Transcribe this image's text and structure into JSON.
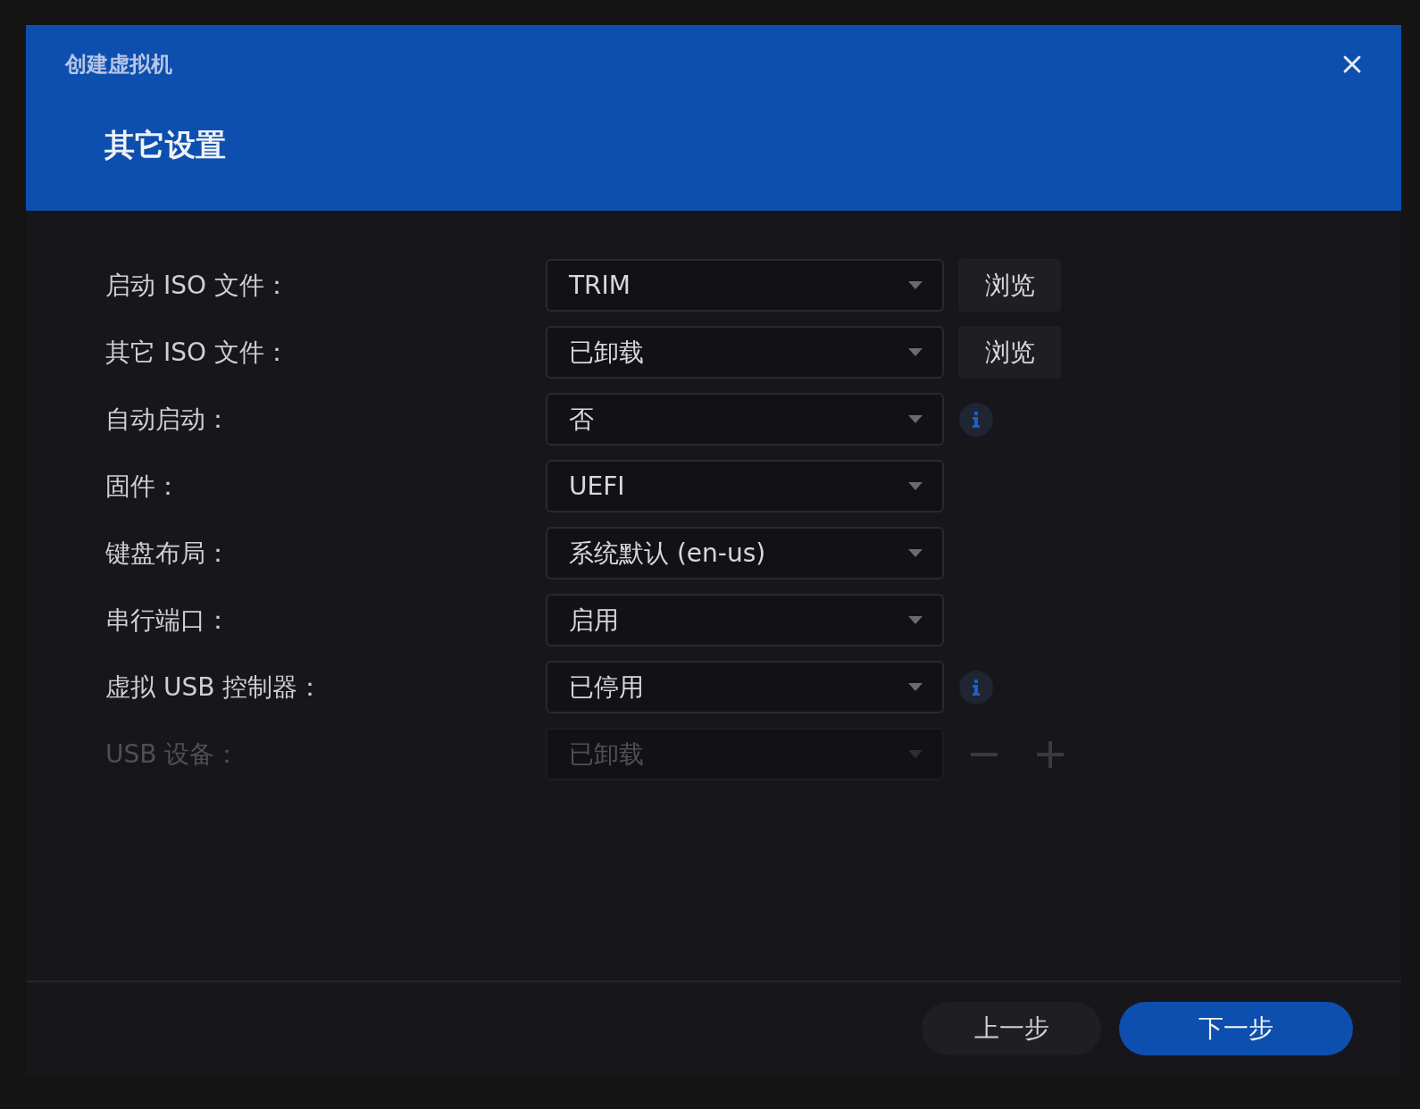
{
  "dialog": {
    "title": "创建虚拟机",
    "heading": "其它设置"
  },
  "rows": [
    {
      "label": "启动 ISO 文件：",
      "value": "TRIM",
      "disabled": false,
      "extra": {
        "kind": "browse",
        "label": "浏览"
      }
    },
    {
      "label": "其它 ISO 文件：",
      "value": "已卸载",
      "disabled": false,
      "extra": {
        "kind": "browse",
        "label": "浏览"
      }
    },
    {
      "label": "自动启动：",
      "value": "否",
      "disabled": false,
      "extra": {
        "kind": "info"
      }
    },
    {
      "label": "固件：",
      "value": "UEFI",
      "disabled": false
    },
    {
      "label": "键盘布局：",
      "value": "系统默认 (en-us)",
      "disabled": false
    },
    {
      "label": "串行端口：",
      "value": "启用",
      "disabled": false
    },
    {
      "label": "虚拟 USB 控制器：",
      "value": "已停用",
      "disabled": false,
      "extra": {
        "kind": "info"
      }
    },
    {
      "label": "USB 设备：",
      "value": "已卸载",
      "disabled": true,
      "extra": {
        "kind": "stepper"
      }
    }
  ],
  "buttons": [
    {
      "label": "上一步",
      "primary": false
    },
    {
      "label": "下一步",
      "primary": true
    }
  ]
}
